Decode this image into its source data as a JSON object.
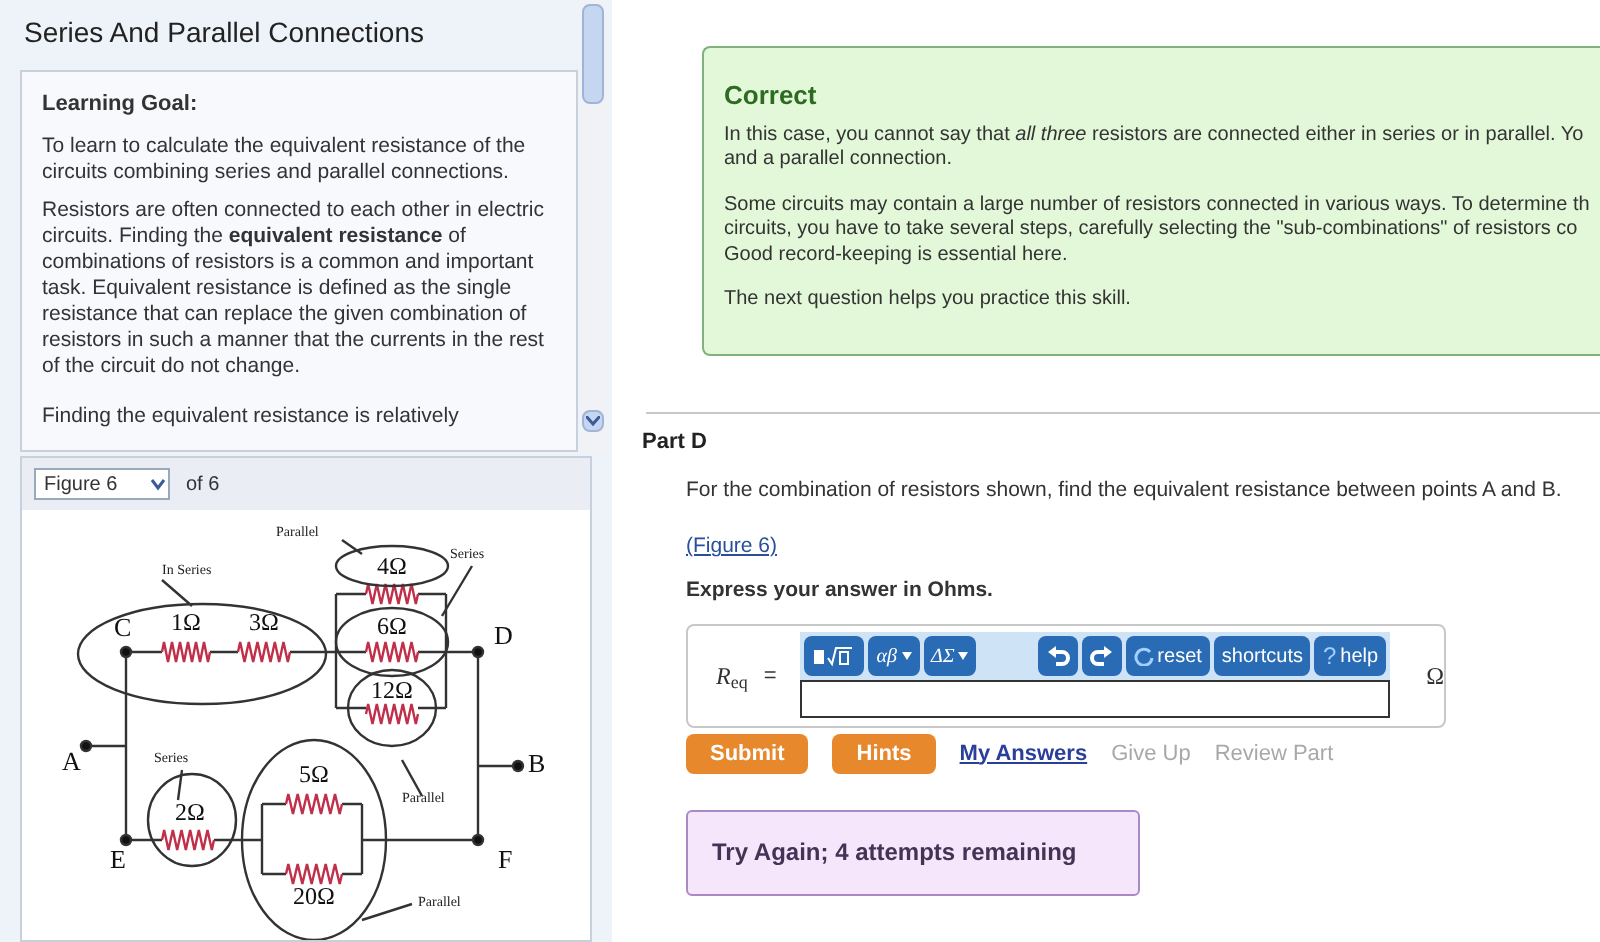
{
  "title": "Series And Parallel Connections",
  "intro": {
    "heading": "Learning Goal:",
    "paragraphs": [
      "To learn to calculate the equivalent resistance of the circuits combining series and parallel connections.",
      "Resistors are often connected to each other in electric circuits. Finding the **equivalent resistance** of combinations of resistors is a common and important task. Equivalent resistance is defined as the single resistance that can replace the given combination of resistors in such a manner that the currents in the rest of the circuit do not change.",
      "Finding the equivalent resistance is relatively"
    ]
  },
  "figure_selector": {
    "value": "Figure 6",
    "total": "of 6"
  },
  "figure": {
    "nodes": [
      "C",
      "D",
      "A",
      "B",
      "E",
      "F"
    ],
    "resistors": [
      "1Ω",
      "3Ω",
      "4Ω",
      "6Ω",
      "12Ω",
      "2Ω",
      "5Ω",
      "20Ω"
    ],
    "notes": [
      "In Series",
      "Parallel",
      "Series",
      "Series",
      "Parallel",
      "Parallel"
    ]
  },
  "feedback": {
    "title": "Correct",
    "paragraphs": [
      [
        "In this case, you cannot say that *all three* resistors are connected either in series or in parallel. Yo",
        "and a parallel connection."
      ],
      [
        "Some circuits may contain a large number of resistors connected in various ways. To determine th",
        "circuits, you have to take several steps, carefully selecting the \"sub-combinations\" of resistors co",
        "Good record-keeping is essential here."
      ],
      [
        "The next question helps you practice this skill."
      ]
    ]
  },
  "part": {
    "title": "Part D",
    "question": "For the combination of resistors shown, find the equivalent resistance between points A and B.",
    "figure_link": "(Figure 6)",
    "instruction": "Express your answer in Ohms.",
    "answer": {
      "label": "*R*$_{eq}$",
      "equals": "=",
      "unit": "Ω",
      "toolbar": [
        {
          "kind": "templates"
        },
        {
          "kind": "menu",
          "label": "αβ"
        },
        {
          "kind": "menu",
          "label": "ΔΣ"
        },
        {
          "kind": "undo"
        },
        {
          "kind": "redo"
        },
        {
          "kind": "reset",
          "label": "reset"
        },
        {
          "kind": "text",
          "label": "shortcuts"
        },
        {
          "kind": "help",
          "mark": "?",
          "label": "help"
        }
      ]
    },
    "actions": [
      {
        "kind": "button",
        "label": "Submit",
        "disabled": false
      },
      {
        "kind": "button",
        "label": "Hints",
        "disabled": false
      },
      {
        "kind": "link",
        "label": "My Answers",
        "disabled": false
      },
      {
        "kind": "link",
        "label": "Give Up",
        "disabled": true
      },
      {
        "kind": "link",
        "label": "Review Part",
        "disabled": true
      }
    ],
    "status": "Try Again; 4 attempts remaining"
  }
}
